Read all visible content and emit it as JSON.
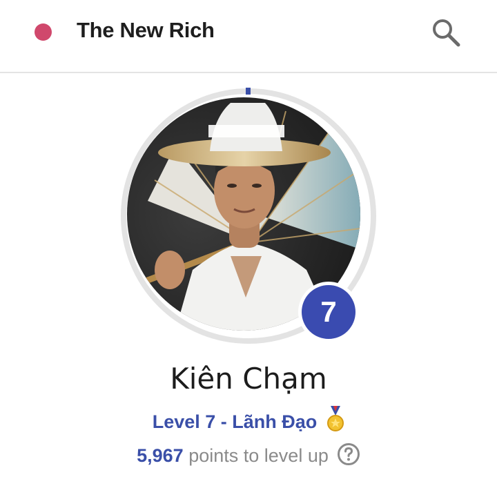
{
  "header": {
    "brand_icon": "community-dot-icon",
    "brand_color": "#d0486c",
    "title": "The New Rich",
    "search_icon": "search-icon"
  },
  "profile": {
    "name": "Kiên Chạm",
    "avatar_icon": "profile-photo",
    "level_number": "7",
    "level_label": "Level 7 - Lãnh Đạo",
    "medal_icon": "medal-icon",
    "points_value": "5,967",
    "points_suffix": "points to level up",
    "help_icon": "help-icon",
    "level_progress": 0.0,
    "accent_color": "#3a4fa8",
    "ring_track_color": "#e3e3e3"
  }
}
